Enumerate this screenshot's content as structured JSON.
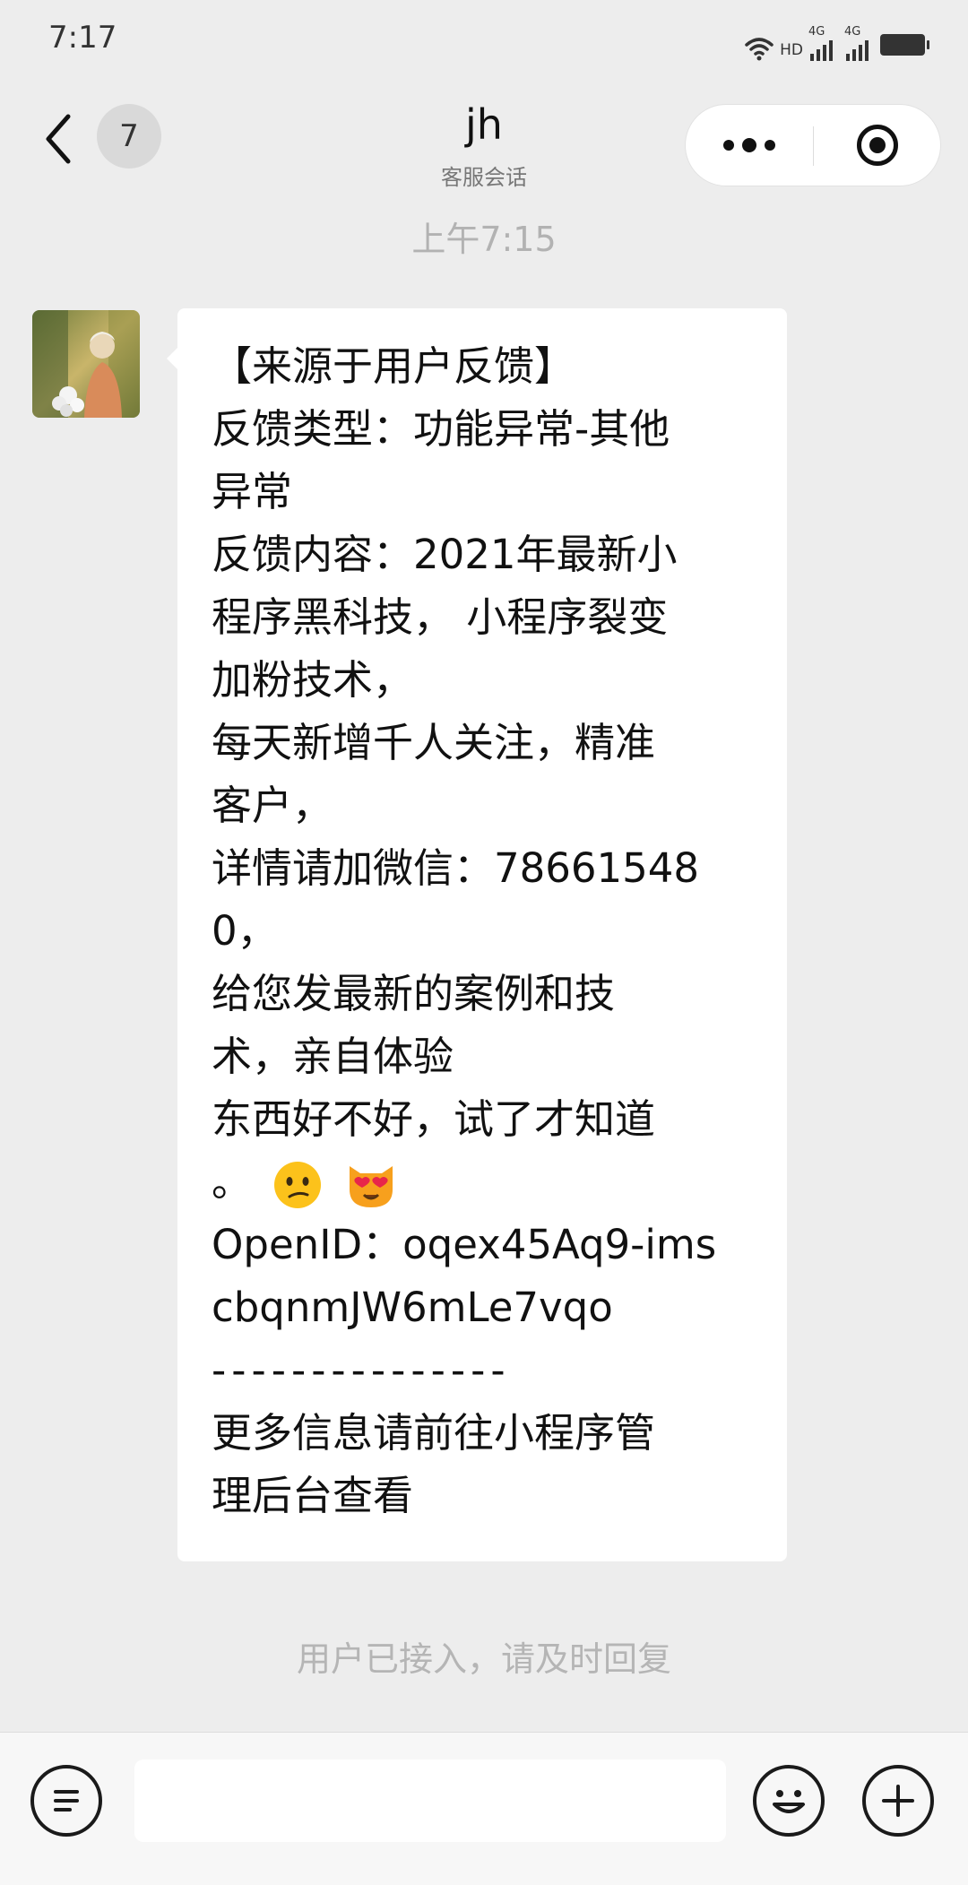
{
  "status_bar": {
    "time": "7:17",
    "hd_label": "HD",
    "network_1": "4G",
    "network_2": "4G"
  },
  "nav": {
    "badge_count": "7",
    "title": "jh",
    "subtitle": "客服会话"
  },
  "chat": {
    "timestamp": "上午7:15",
    "message_lines": [
      "【来源于用户反馈】",
      "反馈类型：功能异常-其他",
      "异常",
      "反馈内容：2021年最新小",
      "程序黑科技， 小程序裂变",
      "加粉技术，",
      "每天新增千人关注，精准",
      "客户，",
      "详情请加微信：78661548",
      "0，",
      "给您发最新的案例和技",
      "术，亲自体验",
      "东西好不好，试了才知道",
      "。",
      "OpenID：oqex45Aq9-ims",
      "cbqnmJW6mLe7vqo",
      "---------------",
      "更多信息请前往小程序管",
      "理后台查看"
    ],
    "emojis": [
      "confused-face",
      "heart-eyes-cat"
    ],
    "system_notice": "用户已接入，请及时回复"
  },
  "input_bar": {
    "placeholder": ""
  },
  "colors": {
    "background": "#ededed",
    "bubble": "#ffffff",
    "muted_text": "#b2b2b2"
  }
}
